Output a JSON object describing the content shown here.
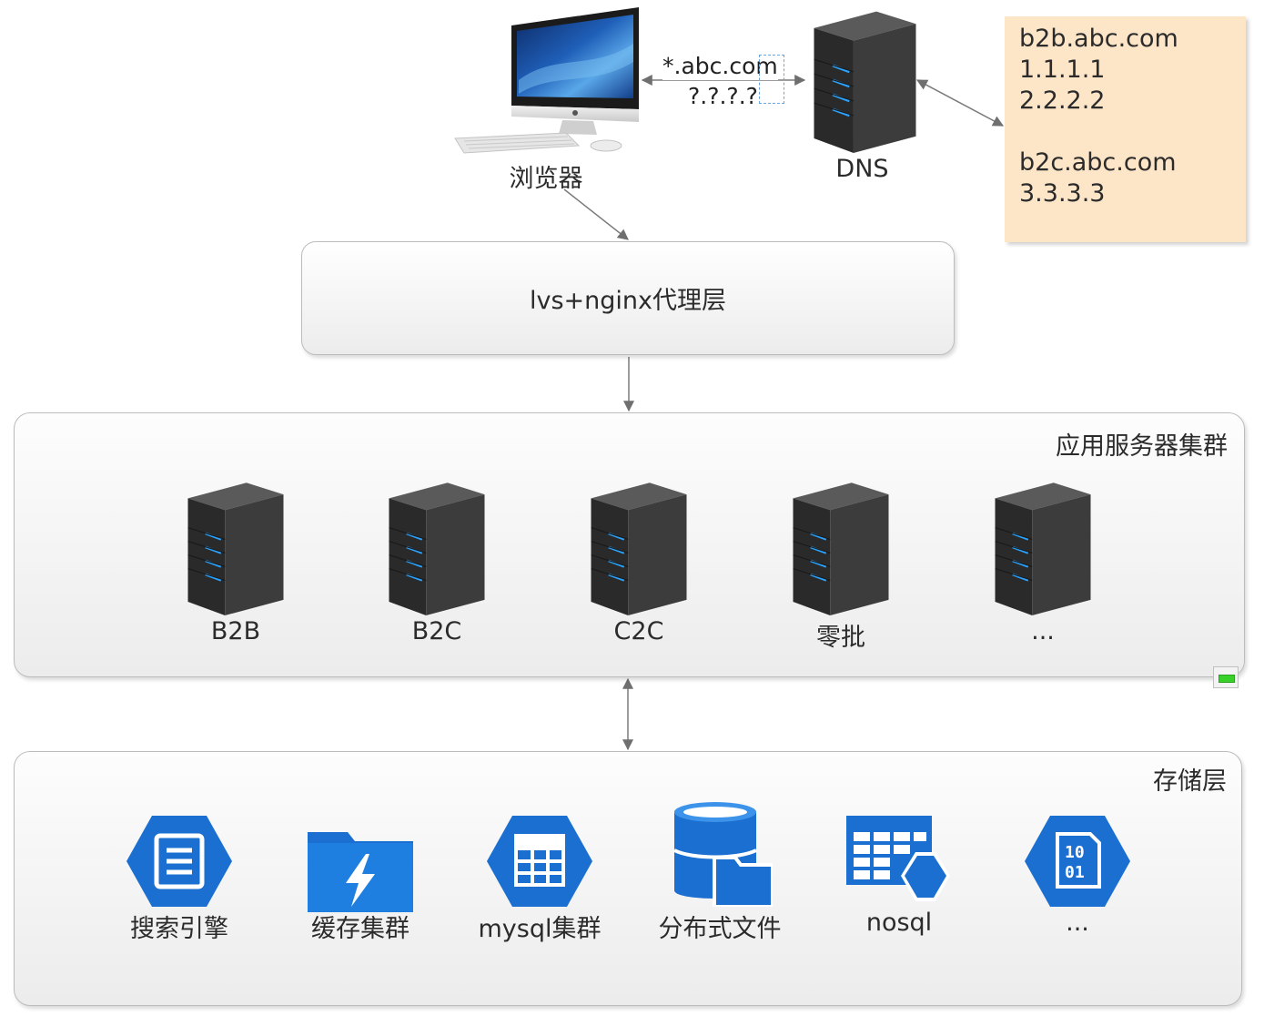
{
  "browser": {
    "label": "浏览器"
  },
  "dns": {
    "label": "DNS"
  },
  "dns_query": {
    "domain": "*.abc.com",
    "answer": "?.?.?.?"
  },
  "dns_records": {
    "lines": [
      "b2b.abc.com",
      "1.1.1.1",
      "2.2.2.2",
      "",
      "b2c.abc.com",
      "3.3.3.3"
    ]
  },
  "proxy_layer": {
    "label": "lvs+nginx代理层"
  },
  "app_cluster": {
    "title": "应用服务器集群",
    "servers": [
      {
        "label": "B2B",
        "icon": "server-tower-icon"
      },
      {
        "label": "B2C",
        "icon": "server-tower-icon"
      },
      {
        "label": "C2C",
        "icon": "server-tower-icon"
      },
      {
        "label": "零批",
        "icon": "server-tower-icon"
      },
      {
        "label": "...",
        "icon": "server-tower-icon"
      }
    ]
  },
  "storage_layer": {
    "title": "存储层",
    "items": [
      {
        "label": "搜索引擎",
        "icon": "search-document-hexagon-icon"
      },
      {
        "label": "缓存集群",
        "icon": "cache-folder-lightning-icon"
      },
      {
        "label": "mysql集群",
        "icon": "table-grid-hexagon-icon"
      },
      {
        "label": "分布式文件",
        "icon": "database-folder-icon"
      },
      {
        "label": "nosql",
        "icon": "table-hexagon-icon"
      },
      {
        "label": "...",
        "icon": "binary-file-hexagon-icon"
      }
    ]
  },
  "colors": {
    "note_background": "#fde5c8",
    "storage_icon_blue": "#1a6fd1",
    "server_led_blue": "#2aa3ff",
    "server_body": "#3a3a3a",
    "arrow_gray": "#7a7a7a"
  }
}
